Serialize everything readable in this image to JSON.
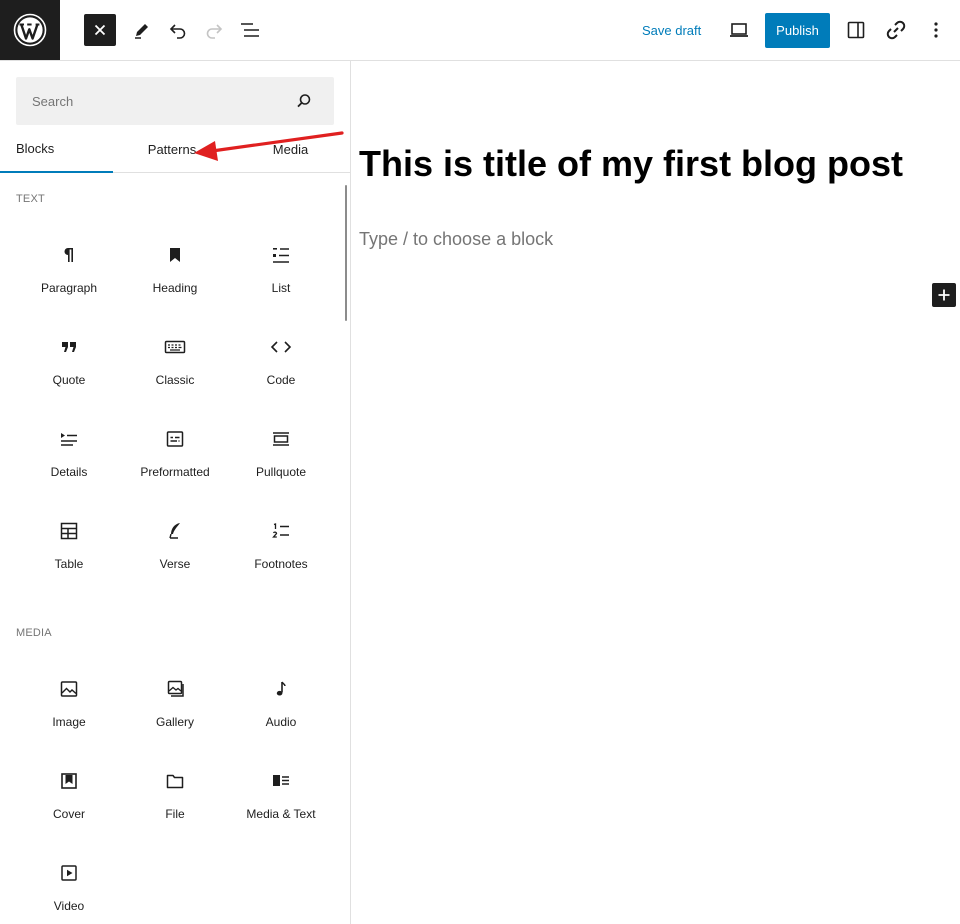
{
  "toolbar": {
    "save_draft_label": "Save draft",
    "publish_label": "Publish"
  },
  "sidebar": {
    "search": {
      "placeholder": "Search",
      "value": ""
    },
    "tabs": [
      {
        "label": "Blocks",
        "active": true
      },
      {
        "label": "Patterns",
        "active": false
      },
      {
        "label": "Media",
        "active": false
      }
    ],
    "categories": [
      {
        "label": "TEXT",
        "blocks": [
          {
            "label": "Paragraph",
            "icon": "paragraph-icon"
          },
          {
            "label": "Heading",
            "icon": "bookmark-heading-icon"
          },
          {
            "label": "List",
            "icon": "list-icon"
          },
          {
            "label": "Quote",
            "icon": "quote-icon"
          },
          {
            "label": "Classic",
            "icon": "keyboard-icon"
          },
          {
            "label": "Code",
            "icon": "code-icon"
          },
          {
            "label": "Details",
            "icon": "details-icon"
          },
          {
            "label": "Preformatted",
            "icon": "preformatted-icon"
          },
          {
            "label": "Pullquote",
            "icon": "pullquote-icon"
          },
          {
            "label": "Table",
            "icon": "table-icon"
          },
          {
            "label": "Verse",
            "icon": "feather-icon"
          },
          {
            "label": "Footnotes",
            "icon": "footnotes-icon"
          }
        ]
      },
      {
        "label": "MEDIA",
        "blocks": [
          {
            "label": "Image",
            "icon": "image-icon"
          },
          {
            "label": "Gallery",
            "icon": "gallery-icon"
          },
          {
            "label": "Audio",
            "icon": "audio-icon"
          },
          {
            "label": "Cover",
            "icon": "cover-icon"
          },
          {
            "label": "File",
            "icon": "folder-icon"
          },
          {
            "label": "Media & Text",
            "icon": "media-text-icon"
          },
          {
            "label": "Video",
            "icon": "video-icon"
          }
        ]
      }
    ]
  },
  "editor": {
    "title": "This is title of my first blog post",
    "placeholder": "Type / to choose a block"
  },
  "colors": {
    "accent": "#007cba",
    "dark": "#1e1e1e",
    "annotation": "#e02020"
  }
}
